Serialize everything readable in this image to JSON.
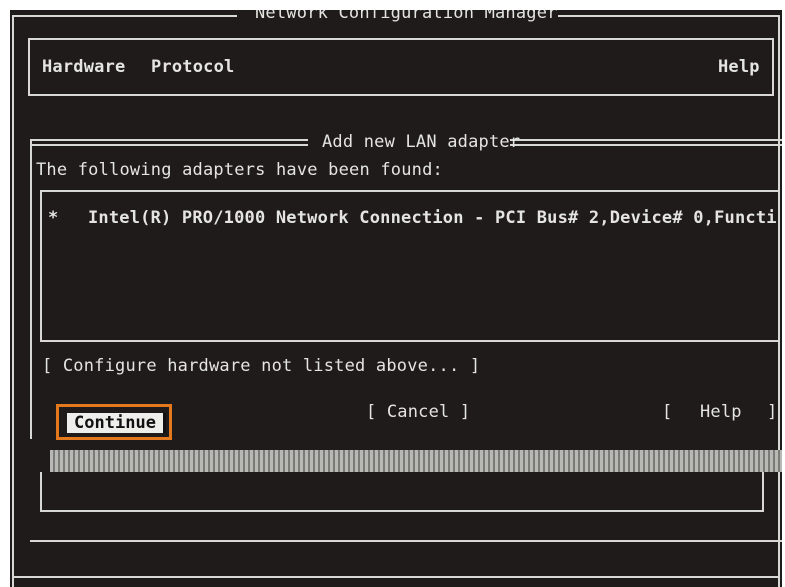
{
  "window": {
    "title": "Network Configuration Manager"
  },
  "menu": {
    "items": [
      {
        "label": "Hardware"
      },
      {
        "label": "Protocol"
      }
    ],
    "help_label": "Help"
  },
  "dialog": {
    "title": "Add new LAN adapter",
    "message": "The following adapters have been found:",
    "adapters": [
      {
        "marker": "*",
        "name": "Intel(R) PRO/1000 Network Connection - PCI Bus# 2,Device# 0,Functi"
      }
    ],
    "configure_link": "[ Configure hardware not listed above... ]",
    "buttons": {
      "continue": "Continue",
      "cancel": "[ Cancel ]",
      "help_open": "[",
      "help_label": "Help",
      "help_close": "]"
    }
  },
  "colors": {
    "background": "#1e1b1a",
    "text": "#e4e4e0",
    "highlight_border": "#e4781c"
  }
}
